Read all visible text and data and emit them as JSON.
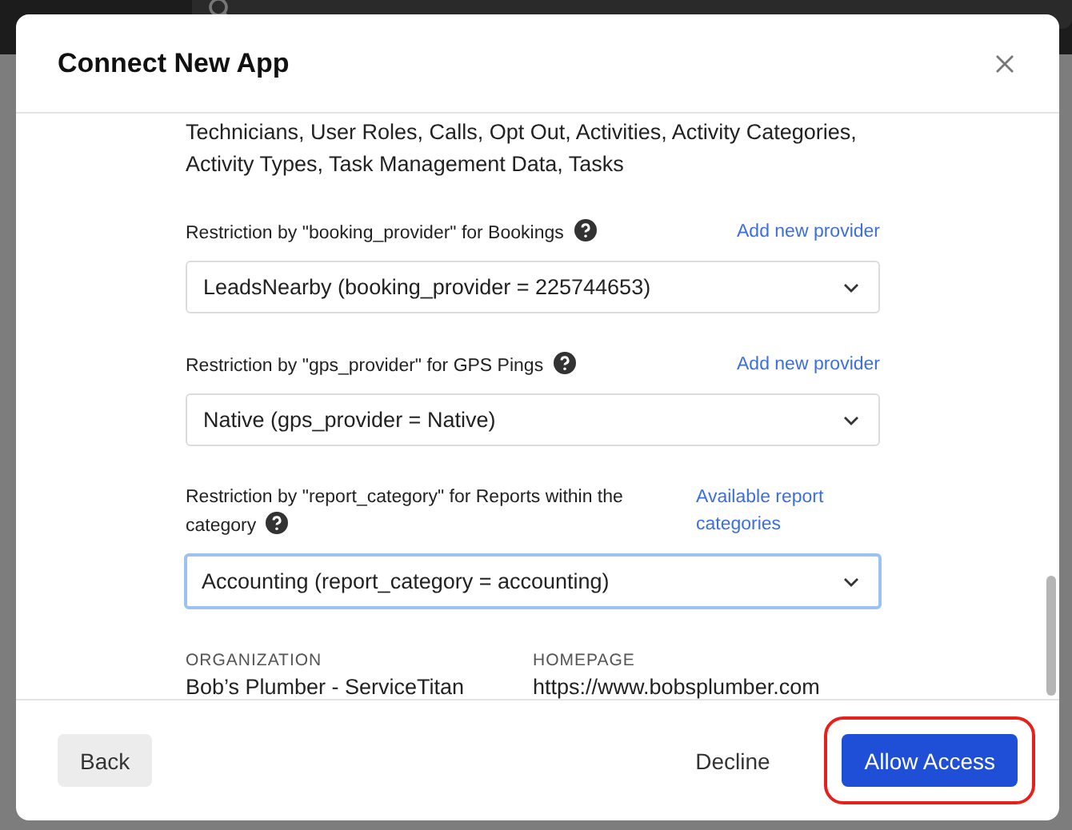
{
  "dialog": {
    "title": "Connect New App",
    "scope_text": "Technicians, User Roles, Calls, Opt Out, Activities, Activity Categories, Activity Types, Task Management Data, Tasks",
    "restrictions": [
      {
        "label": "Restriction by \"booking_provider\" for Bookings",
        "link": "Add new provider",
        "value": "LeadsNearby (booking_provider = 225744653)",
        "focused": false
      },
      {
        "label": "Restriction by \"gps_provider\" for GPS Pings",
        "link": "Add new provider",
        "value": "Native (gps_provider = Native)",
        "focused": false
      },
      {
        "label": "Restriction by \"report_category\" for Reports within the category",
        "link": "Available report categories",
        "value": "Accounting (report_category = accounting)",
        "focused": true
      }
    ],
    "details": [
      {
        "label": "ORGANIZATION",
        "value": "Bob’s Plumber - ServiceTitan"
      },
      {
        "label": "HOMEPAGE",
        "value": "https://www.bobsplumber.com"
      }
    ],
    "buttons": [
      {
        "label": "Back",
        "kind": "secondary",
        "highlighted": false
      },
      {
        "label": "Decline",
        "kind": "text",
        "highlighted": false
      },
      {
        "label": "Allow Access",
        "kind": "primary",
        "highlighted": true
      }
    ]
  }
}
